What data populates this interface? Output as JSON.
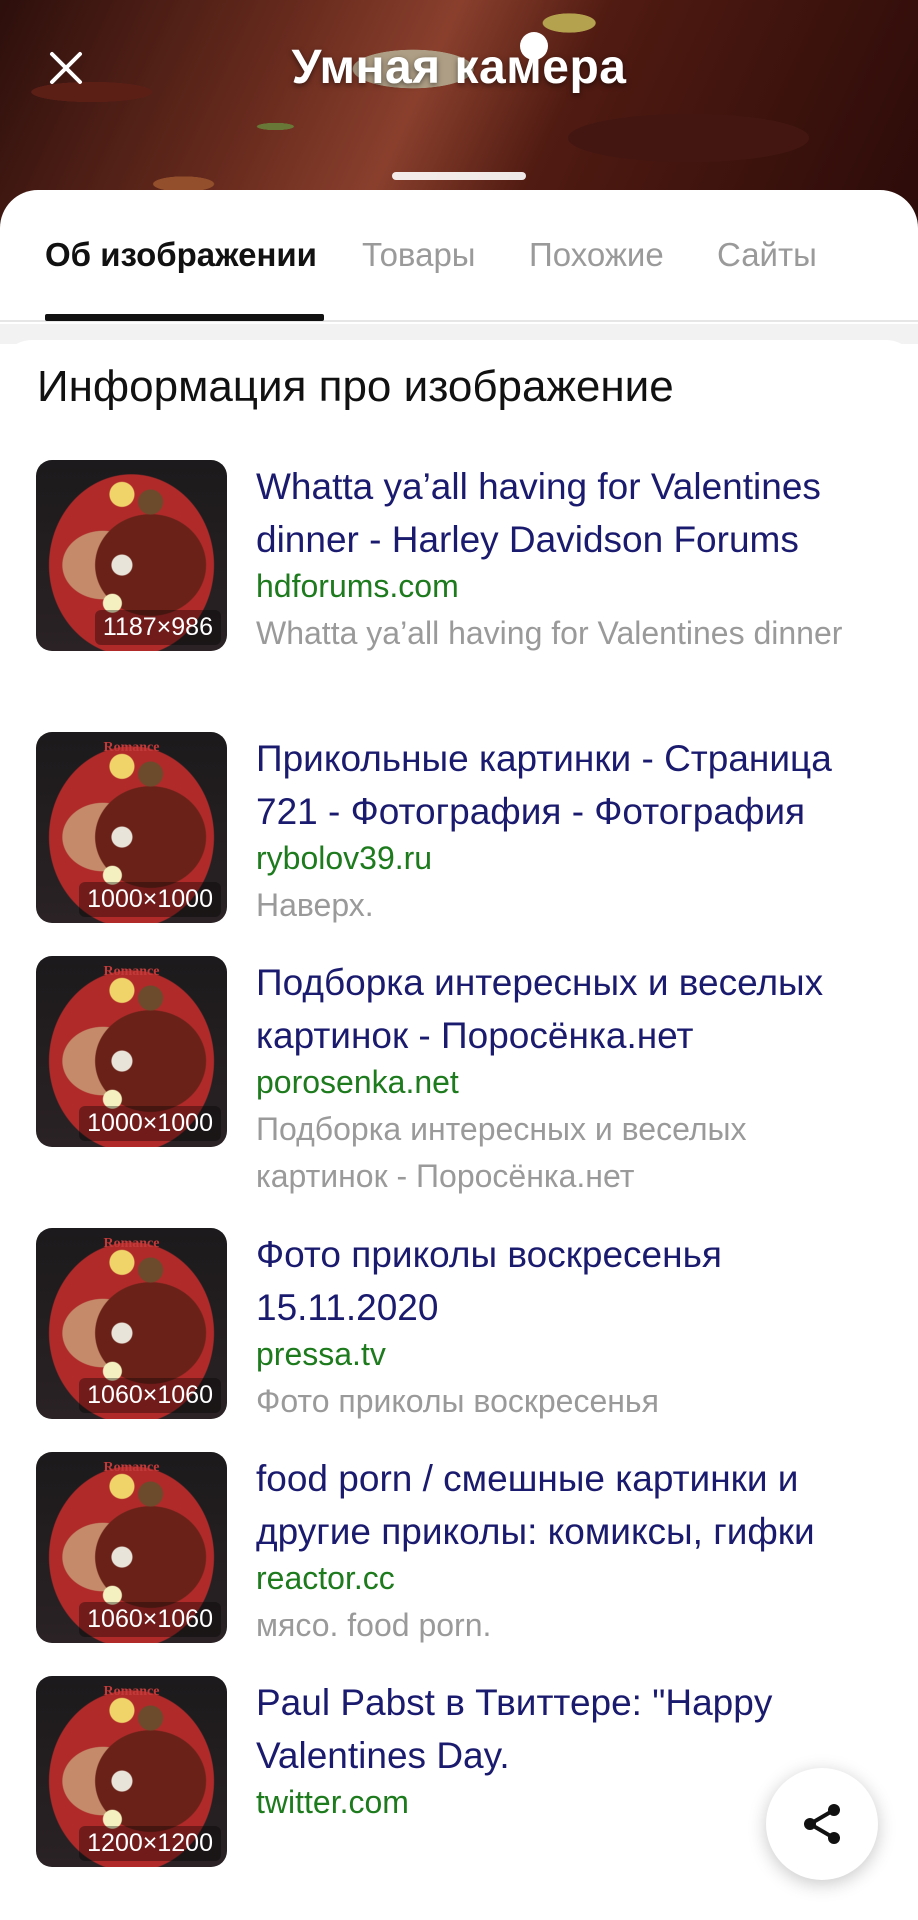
{
  "header": {
    "title": "Умная камера",
    "close_icon": "close-icon"
  },
  "tabs": [
    {
      "label": "Об изображении",
      "active": true
    },
    {
      "label": "Товары",
      "active": false
    },
    {
      "label": "Похожие",
      "active": false
    },
    {
      "label": "Сайты",
      "active": false
    }
  ],
  "section": {
    "title": "Информация про изображение"
  },
  "results": [
    {
      "title": "Whatta ya’all having for Valentines dinner - Harley Davidson Forums",
      "host": "hdforums.com",
      "description": "Whatta ya’all having for Valentines dinner",
      "size": "1187×986",
      "brand": ""
    },
    {
      "title": "Прикольные картинки - Страница 721 - Фотография - Фотография",
      "host": "rybolov39.ru",
      "description": "Наверх.",
      "size": "1000×1000",
      "brand": "Romance"
    },
    {
      "title": "Подборка интересных и веселых картинок - Поросёнка.нет",
      "host": "porosenka.net",
      "description": "Подборка интересных и веселых картинок - Поросёнка.нет",
      "size": "1000×1000",
      "brand": "Romance"
    },
    {
      "title": "Фото приколы воскресенья 15.11.2020",
      "host": "pressa.tv",
      "description": "Фото приколы воскресенья",
      "size": "1060×1060",
      "brand": "Romance"
    },
    {
      "title": "food porn / смешные картинки и другие приколы: комиксы, гифки",
      "host": "reactor.cc",
      "description": "мясо. food porn.",
      "size": "1060×1060",
      "brand": "Romance"
    },
    {
      "title": "Paul Pabst в Твиттере: \"Happy Valentines Day.",
      "host": "twitter.com",
      "description": "",
      "size": "1200×1200",
      "brand": "Romance"
    }
  ],
  "share": {
    "icon": "share-icon"
  },
  "colors": {
    "link": "#1a1a6e",
    "host": "#1d7a1d",
    "muted": "#9a9a9a"
  }
}
